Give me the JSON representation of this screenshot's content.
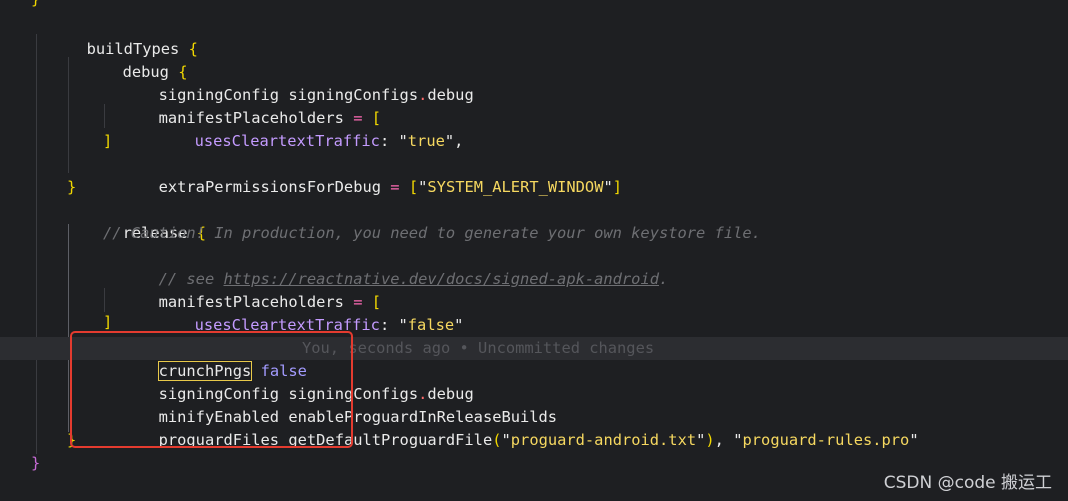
{
  "lines": {
    "l0": {
      "brace": "}"
    },
    "l1": {
      "name": "buildTypes",
      "brace": "{"
    },
    "l2": {
      "name": "debug",
      "brace": "{"
    },
    "l3": {
      "name": "signingConfig",
      "obj": "signingConfigs",
      "dot": ".",
      "prop": "debug"
    },
    "l4": {
      "name": "manifestPlaceholders",
      "op": "=",
      "bracket": "["
    },
    "l5": {
      "key": "usesCleartextTraffic",
      "colon": ":",
      "q1": "\"",
      "value": "true",
      "q2": "\"",
      "comma": ","
    },
    "l6": {
      "bracket": "]"
    },
    "l7": {
      "name": "extraPermissionsForDebug",
      "op": "=",
      "bracket_open": "[",
      "q1": "\"",
      "value": "SYSTEM_ALERT_WINDOW",
      "q2": "\"",
      "bracket_close": "]"
    },
    "l8": {
      "brace": "}"
    },
    "l9": {
      "name": "release",
      "brace": "{"
    },
    "l10": {
      "comment": "// Caution! In production, you need to generate your own keystore file."
    },
    "l11": {
      "comment_prefix": "// see ",
      "link": "https://reactnative.dev/docs/signed-apk-android",
      "comment_suffix": "."
    },
    "l12": {
      "name": "manifestPlaceholders",
      "op": "=",
      "bracket": "["
    },
    "l13": {
      "key": "usesCleartextTraffic",
      "colon": ":",
      "q1": "\"",
      "value": "false",
      "q2": "\""
    },
    "l14": {
      "bracket": "]"
    },
    "l15": {
      "name": "crunchPngs",
      "value": "false",
      "blame": "You, seconds ago • Uncommitted changes"
    },
    "l16": {
      "name": "signingConfig",
      "obj": "signingConfigs",
      "dot": ".",
      "prop": "debug"
    },
    "l17": {
      "name": "minifyEnabled",
      "value": "enableProguardInReleaseBuilds"
    },
    "l18": {
      "name": "proguardFiles",
      "fn": "getDefaultProguardFile",
      "paren_open": "(",
      "q1": "\"",
      "arg1": "proguard-android.txt",
      "q2": "\"",
      "paren_close": ")",
      "comma": ",",
      "q3": "\"",
      "arg2": "proguard-rules.pro",
      "q4": "\""
    },
    "l19": {
      "brace": "}"
    },
    "l20": {
      "brace": "}"
    }
  },
  "watermark": "CSDN @code 搬运工",
  "colors": {
    "background": "#1e1f22",
    "current_line": "#2c2d31",
    "string": "#f6d860",
    "keyword_key": "#c49bff",
    "boolean": "#a39bff",
    "operator": "#ff6bb5",
    "annotation_box": "#e43b2f"
  }
}
